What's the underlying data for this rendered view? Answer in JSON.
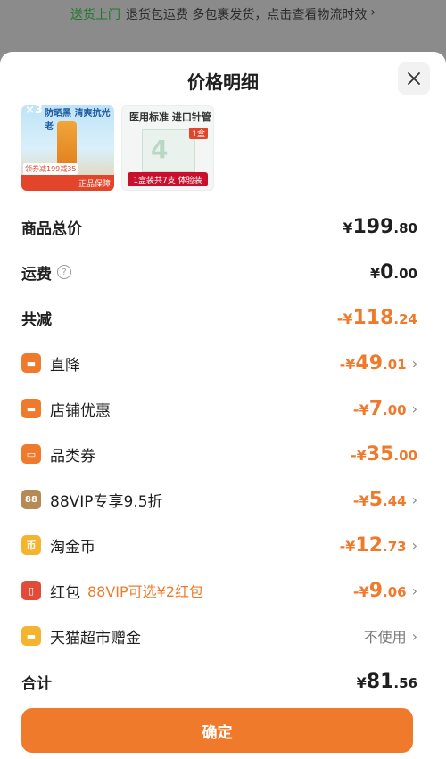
{
  "topbar": {
    "highlight": "送货上门",
    "text": "退货包运费  多包裹发货，点击查看物流时效",
    "chevron": "›"
  },
  "sheet": {
    "title": "价格明细",
    "close_icon": "close-icon"
  },
  "thumbs": [
    {
      "qty": "×3",
      "tagline": "防晒黑 清爽抗光老",
      "promo": "正品保障",
      "promo_small": "领券减199减35"
    },
    {
      "head": "医用标准 进口针管",
      "tag": "1盒",
      "bottom": "1盒装共7支 体验装",
      "boxnum": "4"
    }
  ],
  "rows": {
    "total_goods": {
      "label": "商品总价",
      "sign": "¥",
      "int": "199",
      "dec": ".80"
    },
    "shipping": {
      "label": "运费",
      "help": "?",
      "sign": "¥",
      "int": "0",
      "dec": ".00"
    },
    "total_reduce": {
      "label": "共减",
      "sign": "-¥",
      "int": "118",
      "dec": ".24"
    },
    "direct_drop": {
      "label": "直降",
      "sign": "-¥",
      "int": "49",
      "dec": ".01",
      "chevron": "›"
    },
    "store_discount": {
      "label": "店铺优惠",
      "sign": "-¥",
      "int": "7",
      "dec": ".00",
      "chevron": "›"
    },
    "category_coupon": {
      "label": "品类券",
      "sign": "-¥",
      "int": "35",
      "dec": ".00"
    },
    "vip": {
      "label": "88VIP专享9.5折",
      "badge": "88",
      "sign": "-¥",
      "int": "5",
      "dec": ".44",
      "chevron": "›"
    },
    "taojin": {
      "label": "淘金币",
      "badge": "币",
      "sign": "-¥",
      "int": "12",
      "dec": ".73",
      "chevron": "›"
    },
    "redpacket": {
      "label": "红包",
      "extra": "88VIP可选¥2红包",
      "sign": "-¥",
      "int": "9",
      "dec": ".06",
      "chevron": "›"
    },
    "tmall_gift": {
      "label": "天猫超市赠金",
      "value": "不使用",
      "chevron": "›"
    },
    "sum": {
      "label": "合计",
      "sign": "¥",
      "int": "81",
      "dec": ".56"
    }
  },
  "confirm_label": "确定",
  "colors": {
    "accent": "#f07a2c",
    "text": "#1f1f1f",
    "muted": "#7a7a7a"
  }
}
